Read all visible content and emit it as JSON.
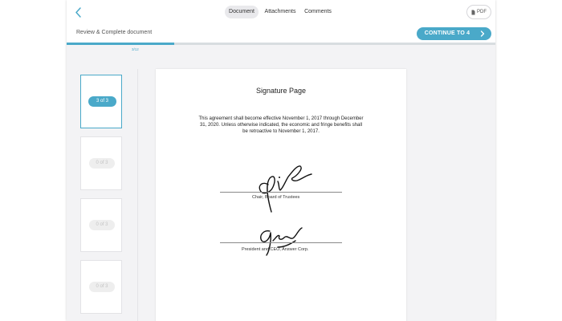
{
  "header": {
    "tabs": [
      {
        "label": "Document",
        "active": true
      },
      {
        "label": "Attachments",
        "active": false
      },
      {
        "label": "Comments",
        "active": false
      }
    ],
    "pdf_label": "PDF",
    "icons": {
      "back": "chevron-left-icon",
      "pdf": "file-icon"
    }
  },
  "subbar": {
    "title": "Review & Complete document",
    "continue_label": "CONTINUE TO 4",
    "continue_icon": "chevron-right-icon"
  },
  "progress": {
    "label": "3/12",
    "fraction": 0.25
  },
  "thumbnails": [
    {
      "label": "3 of 3",
      "active": true
    },
    {
      "label": "0 of 3",
      "active": false
    },
    {
      "label": "0 of 3",
      "active": false
    },
    {
      "label": "0 of 3",
      "active": false
    }
  ],
  "document": {
    "title": "Signature Page",
    "paragraph": "This agreement shall become effective November 1, 2017 through December 31, 2020. Unless otherwise indicated, the economic and fringe benefits shall be retroactive to November 1, 2017.",
    "signatures": [
      {
        "caption": "Chair, Board of Trustees"
      },
      {
        "caption": "President and CEO, Answer Corp."
      }
    ]
  },
  "colors": {
    "accent": "#4aa9c9",
    "background": "#f3f3f5"
  }
}
